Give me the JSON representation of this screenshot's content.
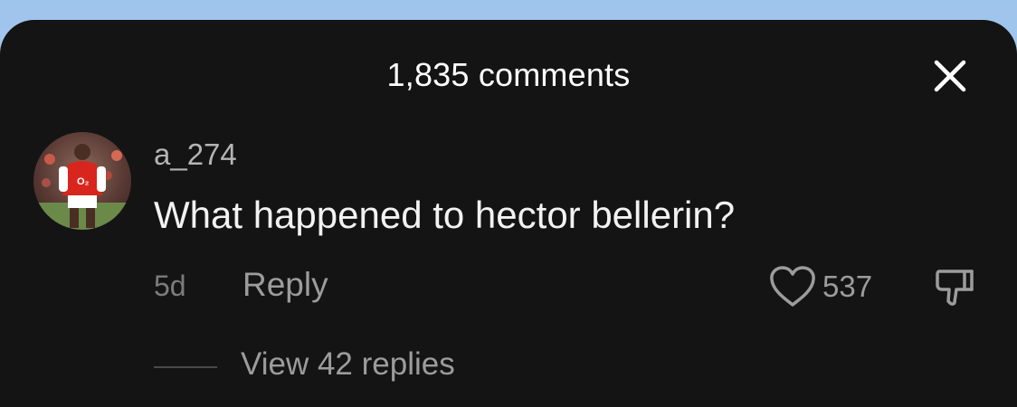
{
  "header": {
    "comment_count_label": "1,835 comments"
  },
  "comment": {
    "username": "a_274",
    "text": "What happened to hector bellerin?",
    "time": "5d",
    "reply_label": "Reply",
    "like_count": "537",
    "view_replies_label": "View 42 replies"
  },
  "icons": {
    "close": "close-icon",
    "like": "heart-icon",
    "dislike": "thumbs-down-icon"
  },
  "colors": {
    "sheet_background": "#141414",
    "primary_text": "#f2f2f2",
    "secondary_text": "#9c9c9c"
  }
}
